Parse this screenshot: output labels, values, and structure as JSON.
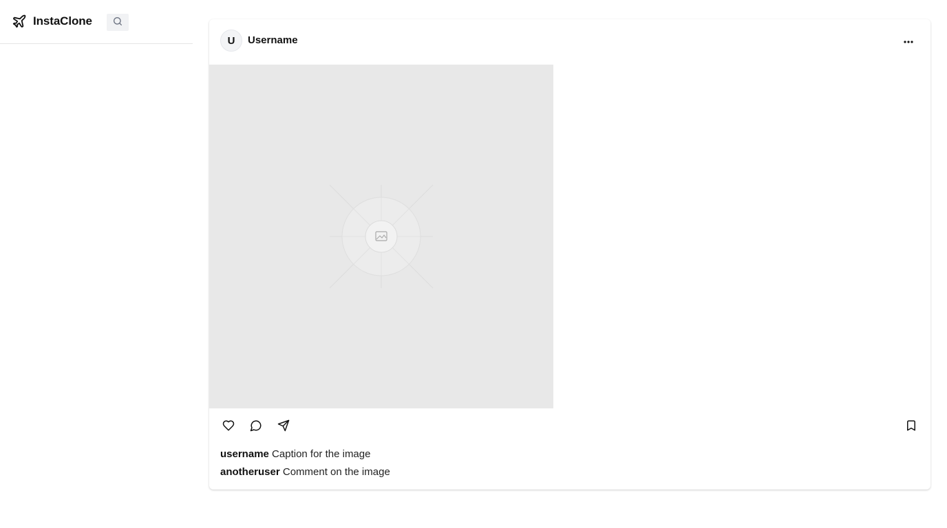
{
  "app": {
    "name": "InstaClone",
    "logo_icon": "plane-icon",
    "search_icon": "search-icon"
  },
  "post": {
    "avatar_initial": "U",
    "username": "Username",
    "more_icon": "ellipsis-icon",
    "image_placeholder_icon": "image-icon",
    "actions": {
      "like_icon": "heart-icon",
      "comment_icon": "comment-icon",
      "share_icon": "send-icon",
      "save_icon": "bookmark-icon"
    },
    "caption": {
      "user": "username",
      "text": "Caption for the image"
    },
    "comments": [
      {
        "user": "anotheruser",
        "text": "Comment on the image"
      }
    ]
  },
  "colors": {
    "image_placeholder_bg": "#e8e8e8",
    "sidebar_border": "#e5e5e5",
    "search_bg": "#f1f2f4"
  }
}
